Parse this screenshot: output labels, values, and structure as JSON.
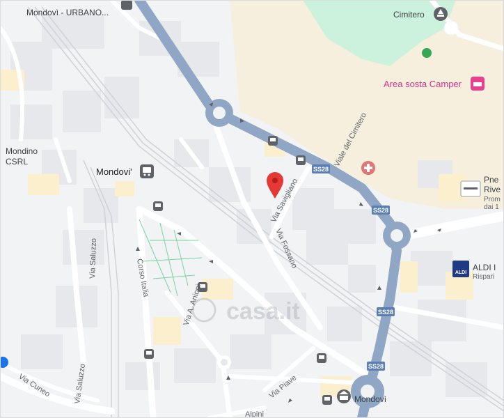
{
  "places": {
    "mondovi_urbano": "Mondovì - URBANO...",
    "cimitero": "Cimitero",
    "area_sosta": "Area sosta Camper",
    "mondino": "Mondino",
    "csrl": "CSRL",
    "mondovi_station": "Mondovi'",
    "pne": "Pne",
    "rive": "Rive",
    "prom": "Prom",
    "dai": "dai 1",
    "aldi": "ALDI I",
    "rispar": "Rispari",
    "mondovi_bottom": "Mondovì"
  },
  "streets": {
    "viale_cimitero": "Viale del Cimitero",
    "via_savigliano": "Via Savigliano",
    "via_fossano": "Via Fossano",
    "via_saluzzo_1": "Via Saluzzo",
    "via_saluzzo_2": "Via Saluzzo",
    "corso_italia": "Corso Italia",
    "via_anioni": "Via A. Anioni",
    "via_cuneo": "Via Cuneo",
    "via_piave": "Via Piave",
    "via_alpini": "Alpini"
  },
  "shields": [
    "SS28",
    "SS28",
    "SS28",
    "SS28"
  ],
  "watermark": "casa.it",
  "aldi_logo": "ALDI",
  "colors": {
    "highway": "#8fa7c4",
    "park": "#c9f0d7",
    "land": "#f7eedc",
    "marker": "#e53935",
    "poi_pink": "#e8418f"
  }
}
